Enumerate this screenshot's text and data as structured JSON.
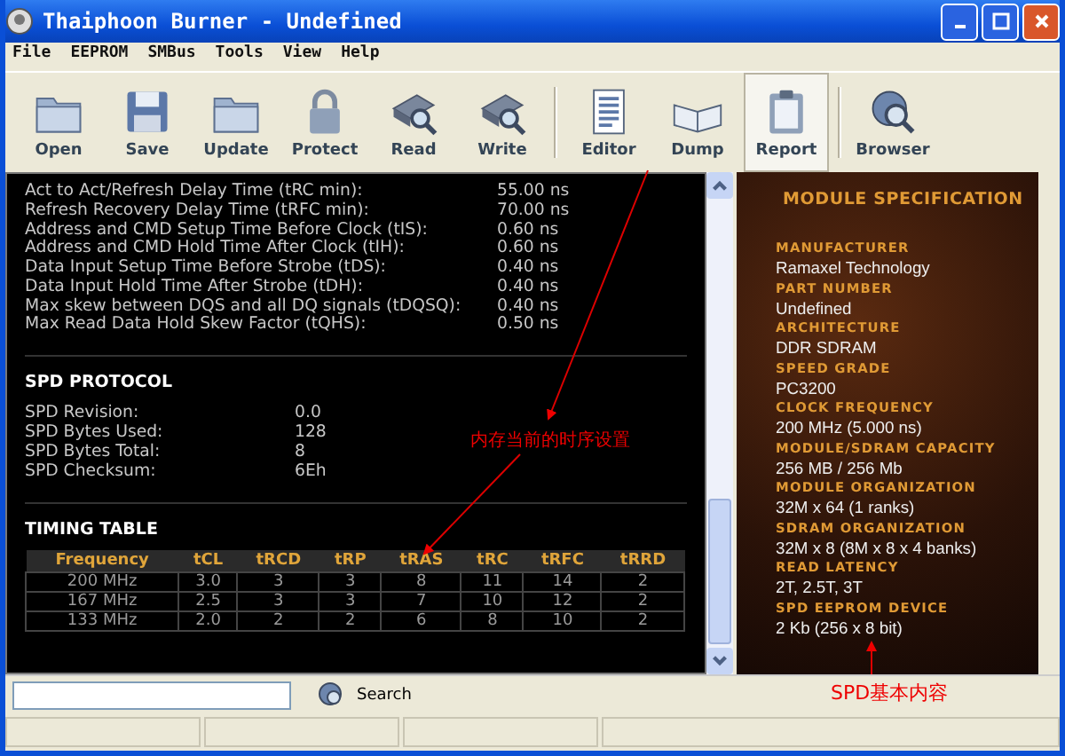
{
  "window": {
    "title": "Thaiphoon Burner - Undefined"
  },
  "menu": [
    "File",
    "EEPROM",
    "SMBus",
    "Tools",
    "View",
    "Help"
  ],
  "toolbar": [
    {
      "label": "Open",
      "selected": false,
      "separator_after": false
    },
    {
      "label": "Save",
      "selected": false,
      "separator_after": false
    },
    {
      "label": "Update",
      "selected": false,
      "separator_after": false
    },
    {
      "label": "Protect",
      "selected": false,
      "separator_after": false
    },
    {
      "label": "Read",
      "selected": false,
      "separator_after": false
    },
    {
      "label": "Write",
      "selected": false,
      "separator_after": true
    },
    {
      "label": "Editor",
      "selected": false,
      "separator_after": false
    },
    {
      "label": "Dump",
      "selected": false,
      "separator_after": false
    },
    {
      "label": "Report",
      "selected": true,
      "separator_after": true
    },
    {
      "label": "Browser",
      "selected": false,
      "separator_after": false
    }
  ],
  "timings": [
    {
      "label": "Act to Act/Refresh Delay Time (tRC min):",
      "value": "55.00 ns"
    },
    {
      "label": "Refresh Recovery Delay Time (tRFC min):",
      "value": "70.00 ns"
    },
    {
      "label": "Address and CMD Setup Time Before Clock (tIS):",
      "value": "0.60 ns"
    },
    {
      "label": "Address and CMD Hold Time After Clock (tIH):",
      "value": "0.60 ns"
    },
    {
      "label": "Data Input Setup Time Before Strobe (tDS):",
      "value": "0.40 ns"
    },
    {
      "label": "Data Input Hold Time After Strobe (tDH):",
      "value": "0.40 ns"
    },
    {
      "label": "Max skew between DQS and all DQ signals (tDQSQ):",
      "value": "0.40 ns"
    },
    {
      "label": "Max Read Data Hold Skew Factor (tQHS):",
      "value": "0.50 ns"
    }
  ],
  "spd_protocol": {
    "title": "SPD PROTOCOL",
    "rows": [
      {
        "label": "SPD Revision:",
        "value": "0.0"
      },
      {
        "label": "SPD Bytes Used:",
        "value": "128"
      },
      {
        "label": "SPD Bytes Total:",
        "value": "8"
      },
      {
        "label": "SPD Checksum:",
        "value": "6Eh"
      }
    ]
  },
  "timing_table": {
    "title": "TIMING TABLE",
    "columns": [
      "Frequency",
      "tCL",
      "tRCD",
      "tRP",
      "tRAS",
      "tRC",
      "tRFC",
      "tRRD"
    ],
    "rows": [
      [
        "200 MHz",
        "3.0",
        "3",
        "3",
        "8",
        "11",
        "14",
        "2"
      ],
      [
        "167 MHz",
        "2.5",
        "3",
        "3",
        "7",
        "10",
        "12",
        "2"
      ],
      [
        "133 MHz",
        "2.0",
        "2",
        "2",
        "6",
        "8",
        "10",
        "2"
      ]
    ]
  },
  "module_specification": {
    "title": "MODULE SPECIFICATION",
    "items": [
      {
        "label": "MANUFACTURER",
        "value": "Ramaxel Technology"
      },
      {
        "label": "PART NUMBER",
        "value": "Undefined"
      },
      {
        "label": "ARCHITECTURE",
        "value": "DDR SDRAM"
      },
      {
        "label": "SPEED GRADE",
        "value": "PC3200"
      },
      {
        "label": "CLOCK FREQUENCY",
        "value": "200 MHz (5.000 ns)"
      },
      {
        "label": "MODULE/SDRAM CAPACITY",
        "value": "256 MB / 256 Mb"
      },
      {
        "label": "MODULE ORGANIZATION",
        "value": "32M x 64 (1 ranks)"
      },
      {
        "label": "SDRAM ORGANIZATION",
        "value": "32M x 8 (8M x 8 x 4 banks)"
      },
      {
        "label": "READ LATENCY",
        "value": "2T, 2.5T, 3T"
      },
      {
        "label": "SPD EEPROM DEVICE",
        "value": "2 Kb (256 x 8 bit)"
      }
    ]
  },
  "annotations": [
    "内存当前的时序设置",
    "SPD基本内容"
  ],
  "search": {
    "button": "Search"
  }
}
